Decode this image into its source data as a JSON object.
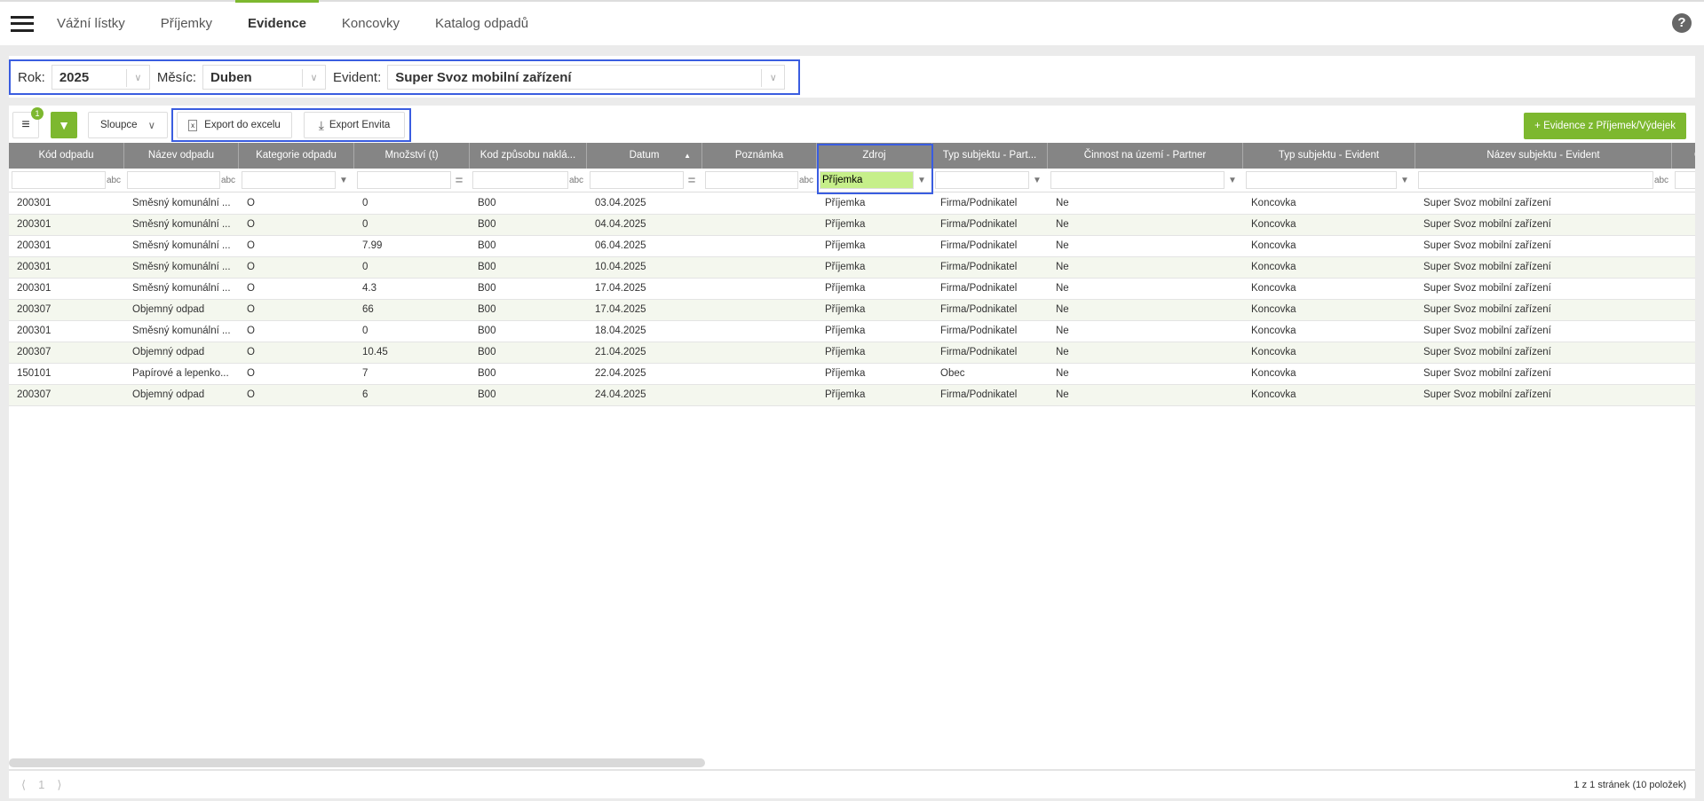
{
  "nav": {
    "tabs": [
      "Vážní lístky",
      "Příjemky",
      "Evidence",
      "Koncovky",
      "Katalog odpadů"
    ],
    "active": "Evidence",
    "help": "?"
  },
  "filters": {
    "rok_label": "Rok:",
    "rok": "2025",
    "mesic_label": "Měsíc:",
    "mesic": "Duben",
    "evident_label": "Evident:",
    "evident": "Super Svoz mobilní zařízení"
  },
  "toolbar": {
    "filter_badge": "1",
    "columns": "Sloupce",
    "export_excel": "Export do excelu",
    "export_envita": "Export Envita",
    "add": "+ Evidence z Příjemek/Výdejek"
  },
  "columns": [
    "Kód odpadu",
    "Název odpadu",
    "Kategorie odpadu",
    "Množství (t)",
    "Kod způsobu naklá...",
    "Datum",
    "Poznámka",
    "Zdroj",
    "Typ subjektu - Part...",
    "Činnost na území - Partner",
    "Typ subjektu - Evident",
    "Název subjektu - Evident",
    "O"
  ],
  "filter_values": {
    "zdroj": "Příjemka"
  },
  "rows": [
    [
      "200301",
      "Směsný komunální ...",
      "O",
      "0",
      "B00",
      "03.04.2025",
      "",
      "Příjemka",
      "Firma/Podnikatel",
      "Ne",
      "Koncovka",
      "Super Svoz mobilní zařízení"
    ],
    [
      "200301",
      "Směsný komunální ...",
      "O",
      "0",
      "B00",
      "04.04.2025",
      "",
      "Příjemka",
      "Firma/Podnikatel",
      "Ne",
      "Koncovka",
      "Super Svoz mobilní zařízení"
    ],
    [
      "200301",
      "Směsný komunální ...",
      "O",
      "7.99",
      "B00",
      "06.04.2025",
      "",
      "Příjemka",
      "Firma/Podnikatel",
      "Ne",
      "Koncovka",
      "Super Svoz mobilní zařízení"
    ],
    [
      "200301",
      "Směsný komunální ...",
      "O",
      "0",
      "B00",
      "10.04.2025",
      "",
      "Příjemka",
      "Firma/Podnikatel",
      "Ne",
      "Koncovka",
      "Super Svoz mobilní zařízení"
    ],
    [
      "200301",
      "Směsný komunální ...",
      "O",
      "4.3",
      "B00",
      "17.04.2025",
      "",
      "Příjemka",
      "Firma/Podnikatel",
      "Ne",
      "Koncovka",
      "Super Svoz mobilní zařízení"
    ],
    [
      "200307",
      "Objemný odpad",
      "O",
      "66",
      "B00",
      "17.04.2025",
      "",
      "Příjemka",
      "Firma/Podnikatel",
      "Ne",
      "Koncovka",
      "Super Svoz mobilní zařízení"
    ],
    [
      "200301",
      "Směsný komunální ...",
      "O",
      "0",
      "B00",
      "18.04.2025",
      "",
      "Příjemka",
      "Firma/Podnikatel",
      "Ne",
      "Koncovka",
      "Super Svoz mobilní zařízení"
    ],
    [
      "200307",
      "Objemný odpad",
      "O",
      "10.45",
      "B00",
      "21.04.2025",
      "",
      "Příjemka",
      "Firma/Podnikatel",
      "Ne",
      "Koncovka",
      "Super Svoz mobilní zařízení"
    ],
    [
      "150101",
      "Papírové a lepenko...",
      "O",
      "7",
      "B00",
      "22.04.2025",
      "",
      "Příjemka",
      "Obec",
      "Ne",
      "Koncovka",
      "Super Svoz mobilní zařízení"
    ],
    [
      "200307",
      "Objemný odpad",
      "O",
      "6",
      "B00",
      "24.04.2025",
      "",
      "Příjemka",
      "Firma/Podnikatel",
      "Ne",
      "Koncovka",
      "Super Svoz mobilní zařízení"
    ]
  ],
  "pager": {
    "page": "1",
    "info": "1 z 1 stránek (10 položek)"
  },
  "colors": {
    "accent": "#7db82f",
    "header": "#858585",
    "highlight": "#3a5de0"
  }
}
